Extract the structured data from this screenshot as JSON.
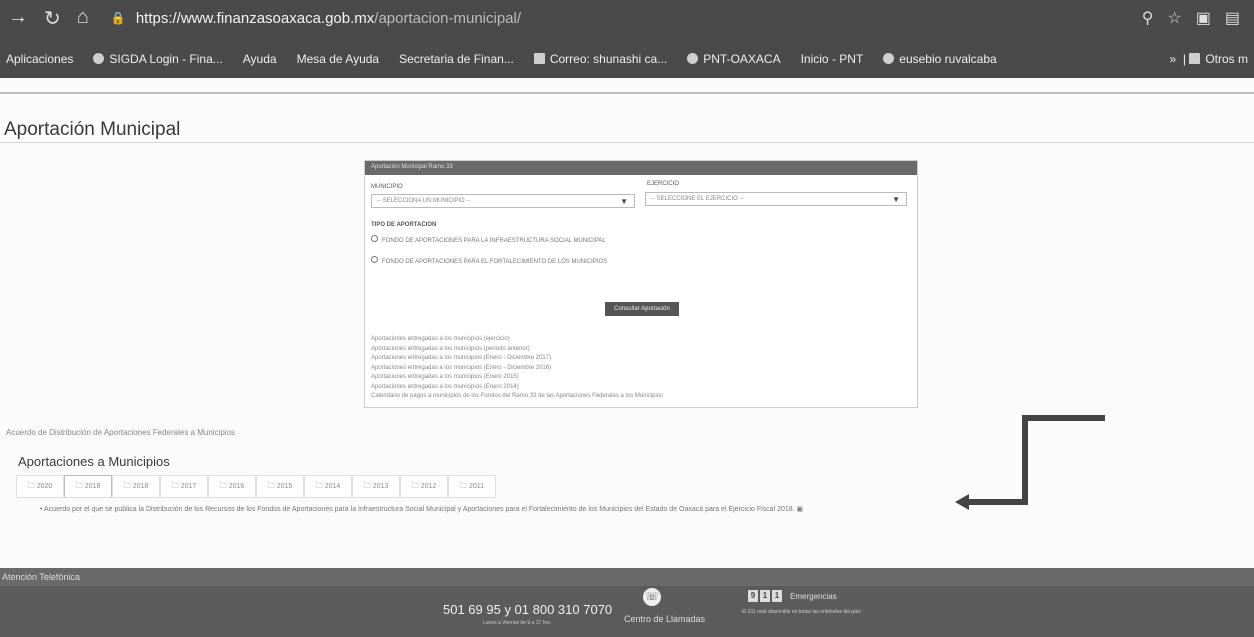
{
  "browser": {
    "url_host": "https://www.finanzasoaxaca.gob.mx",
    "url_path": "/aportacion-municipal/",
    "bookmarks": [
      "Aplicaciones",
      "SIGDA Login - Fina...",
      "Ayuda",
      "Mesa de Ayuda",
      "Secretaria de Finan...",
      "Correo: shunashi ca...",
      "PNT-OAXACA",
      "Inicio - PNT",
      "eusebio ruvalcaba"
    ],
    "bookmarks_more": "»",
    "other_bookmarks": "Otros m"
  },
  "page": {
    "title": "Aportación Municipal"
  },
  "panel": {
    "header": "Aportación Municipal Ramo 33",
    "municipio_label": "MUNICIPIO",
    "municipio_value": "-- SELECCIONA UN MUNICIPIO --",
    "ejercicio_label": "EJERCICIO",
    "ejercicio_value": "-- SELECCIONE EL EJERCICIO --",
    "tipo_label": "TIPO DE APORTACION",
    "radio1": "FONDO DE APORTACIONES PARA LA INFRAESTRUCTURA SOCIAL MUNICIPAL",
    "radio2": "FONDO DE APORTACIONES PARA EL FORTALECIMIENTO DE LOS MUNICIPIOS",
    "button": "Consultar Aportación",
    "links": [
      "Aportaciones entregadas a los municipios (ejercicio)",
      "Aportaciones entregadas a los municipios (periodo anterior)",
      "Aportaciones entregadas a los municipios (Enero - Diciembre 2017)",
      "Aportaciones entregadas a los municipios (Enero - Diciembre 2016)",
      "Aportaciones entregadas a los municipios (Enero 2015)",
      "Aportaciones entregadas a los municipios (Enero 2014)",
      "Calendario de pagos a municipios de los Fondos del Ramo 33 de las Aportaciones Federales a los Municipios"
    ]
  },
  "info_text": "Acuerdo de Distribución de Aportaciones Federales a Municipios",
  "section": {
    "title": "Aportaciones a Municipios",
    "tabs": [
      "2020",
      "2019",
      "2018",
      "2017",
      "2016",
      "2015",
      "2014",
      "2013",
      "2012",
      "2011"
    ],
    "description": "Acuerdo por el que se publica la Distribución de los Recursos de los Fondos de Aportaciones para la Infraestructura Social Municipal y Aportaciones para el Fortalecimiento de los Municipios del Estado de Oaxaca para el Ejercicio Fiscal 2018."
  },
  "footer": {
    "label": "Atención Telefónica",
    "phone": "501 69 95 y 01 800 310 7070",
    "phone_sub": "Lunes a Viernes de 9 a 17 hrs.",
    "call_center": "Centro de Llamadas",
    "emergency_digits": [
      "9",
      "1",
      "1"
    ],
    "emergency_label": "Emergencias",
    "emergency_sub": "El 911 está disponible en todas las entidades del país"
  }
}
